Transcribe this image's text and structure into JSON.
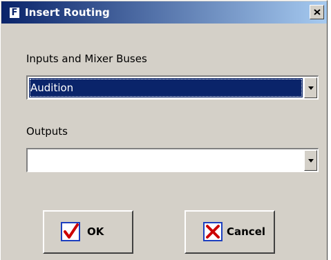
{
  "window": {
    "title": "Insert Routing",
    "icon_letter": "F"
  },
  "inputs": {
    "label": "Inputs and Mixer Buses",
    "selected_value": "Audition"
  },
  "outputs": {
    "label": "Outputs",
    "selected_value": ""
  },
  "buttons": {
    "ok_label": "OK",
    "cancel_label": "Cancel"
  },
  "icons": {
    "title": "app-f-icon",
    "close": "close-x-icon",
    "dropdown": "chevron-down-icon",
    "ok": "checkmark-icon",
    "cancel": "cross-icon"
  },
  "colors": {
    "titlebar_start": "#0a246a",
    "titlebar_end": "#a6caf0",
    "selection": "#0a246a",
    "face": "#d4d0c8",
    "check_red": "#cc0000",
    "icon_blue_border": "#1c3fbf"
  }
}
